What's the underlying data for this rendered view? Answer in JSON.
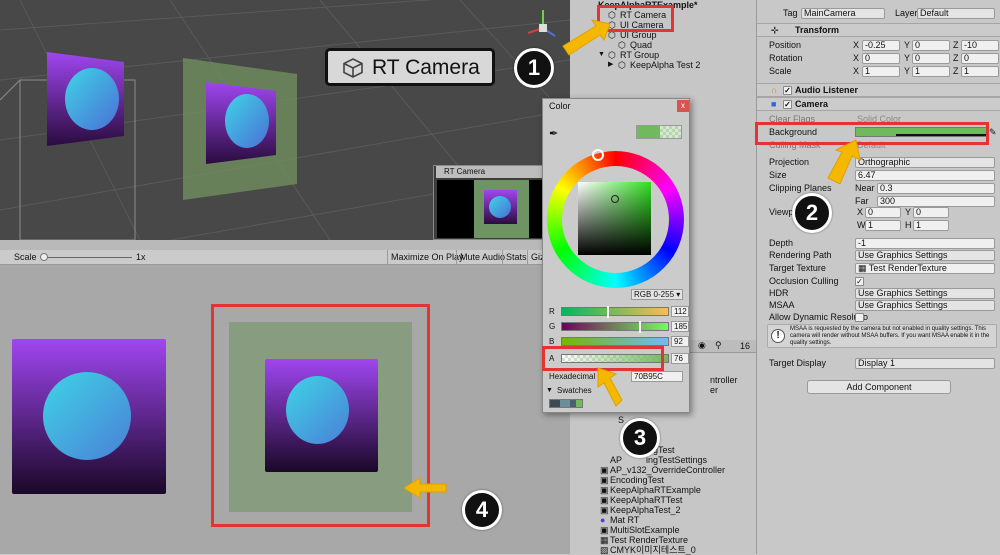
{
  "scene": {
    "rt_camera_label": "RT Camera",
    "preview_title": "RT Camera"
  },
  "game_toolbar": {
    "scale_label": "Scale",
    "scale_value": "1x",
    "maximize": "Maximize On Play",
    "mute": "Mute Audio",
    "stats": "Stats",
    "gizmos": "Gizm"
  },
  "hierarchy": {
    "items": [
      "KeepAlphaRTExample*",
      "RT Camera",
      "UI Camera",
      "UI Group",
      "Quad",
      "RT Group",
      "KeepAlpha Test 2"
    ]
  },
  "project": {
    "count_badge": "16",
    "items": [
      "ntroller",
      "er",
      "AP_v132_OverrideController",
      "EncodingTest",
      "KeepAlphaRTExample",
      "KeepAlphaRTTest",
      "KeepAlphaTest_2",
      "Mat RT",
      "MultiSlotExample",
      "Test RenderTexture",
      "CMYK이미지테스트_0"
    ],
    "partial_items": [
      "ingTest",
      "AP",
      "ingTestSettings",
      "S"
    ]
  },
  "color_picker": {
    "title": "Color",
    "mode": "RGB 0-255",
    "r_label": "R",
    "r_value": "112",
    "g_label": "G",
    "g_value": "185",
    "b_label": "B",
    "b_value": "92",
    "a_label": "A",
    "a_value": "76",
    "hex_label": "Hexadecimal",
    "hex_value": "70B95C",
    "swatches_label": "Swatches",
    "colors": {
      "current": "#70b95c"
    }
  },
  "inspector": {
    "tag_label": "Tag",
    "tag_value": "MainCamera",
    "layer_label": "Layer",
    "layer_value": "Default",
    "transform_title": "Transform",
    "position_label": "Position",
    "pos_x": "-0.25",
    "pos_y": "0",
    "pos_z": "-10",
    "rotation_label": "Rotation",
    "rot_x": "0",
    "rot_y": "0",
    "rot_z": "0",
    "scale_label": "Scale",
    "scl_x": "1",
    "scl_y": "1",
    "scl_z": "1",
    "audio_title": "Audio Listener",
    "camera_title": "Camera",
    "clear_flags_label": "Clear Flags",
    "clear_flags_value": "Solid Color",
    "background_label": "Background",
    "culling_label": "Culling Mask",
    "culling_value": "Default",
    "projection_label": "Projection",
    "projection_value": "Orthographic",
    "size_label": "Size",
    "size_value": "6.47",
    "clipping_label": "Clipping Planes",
    "near_label": "Near",
    "near_value": "0.3",
    "far_label": "Far",
    "far_value": "300",
    "viewport_label": "Viewport Rect",
    "vp_x": "0",
    "vp_y": "0",
    "vp_w": "1",
    "vp_h": "1",
    "depth_label": "Depth",
    "depth_value": "-1",
    "rendering_label": "Rendering Path",
    "rendering_value": "Use Graphics Settings",
    "target_tex_label": "Target Texture",
    "target_tex_value": "Test RenderTexture",
    "occlusion_label": "Occlusion Culling",
    "hdr_label": "HDR",
    "hdr_value": "Use Graphics Settings",
    "msaa_label": "MSAA",
    "msaa_value": "Use Graphics Settings",
    "dyn_res_label": "Allow Dynamic Resolutio",
    "msaa_info": "MSAA is requested by the camera but not enabled in quality settings. This camera will render without MSAA buffers. If you want MSAA enable it in the quality settings.",
    "target_display_label": "Target Display",
    "target_display_value": "Display 1",
    "add_component": "Add Component"
  },
  "annotations": {
    "b1": "1",
    "b2": "2",
    "b3": "3",
    "b4": "4"
  }
}
